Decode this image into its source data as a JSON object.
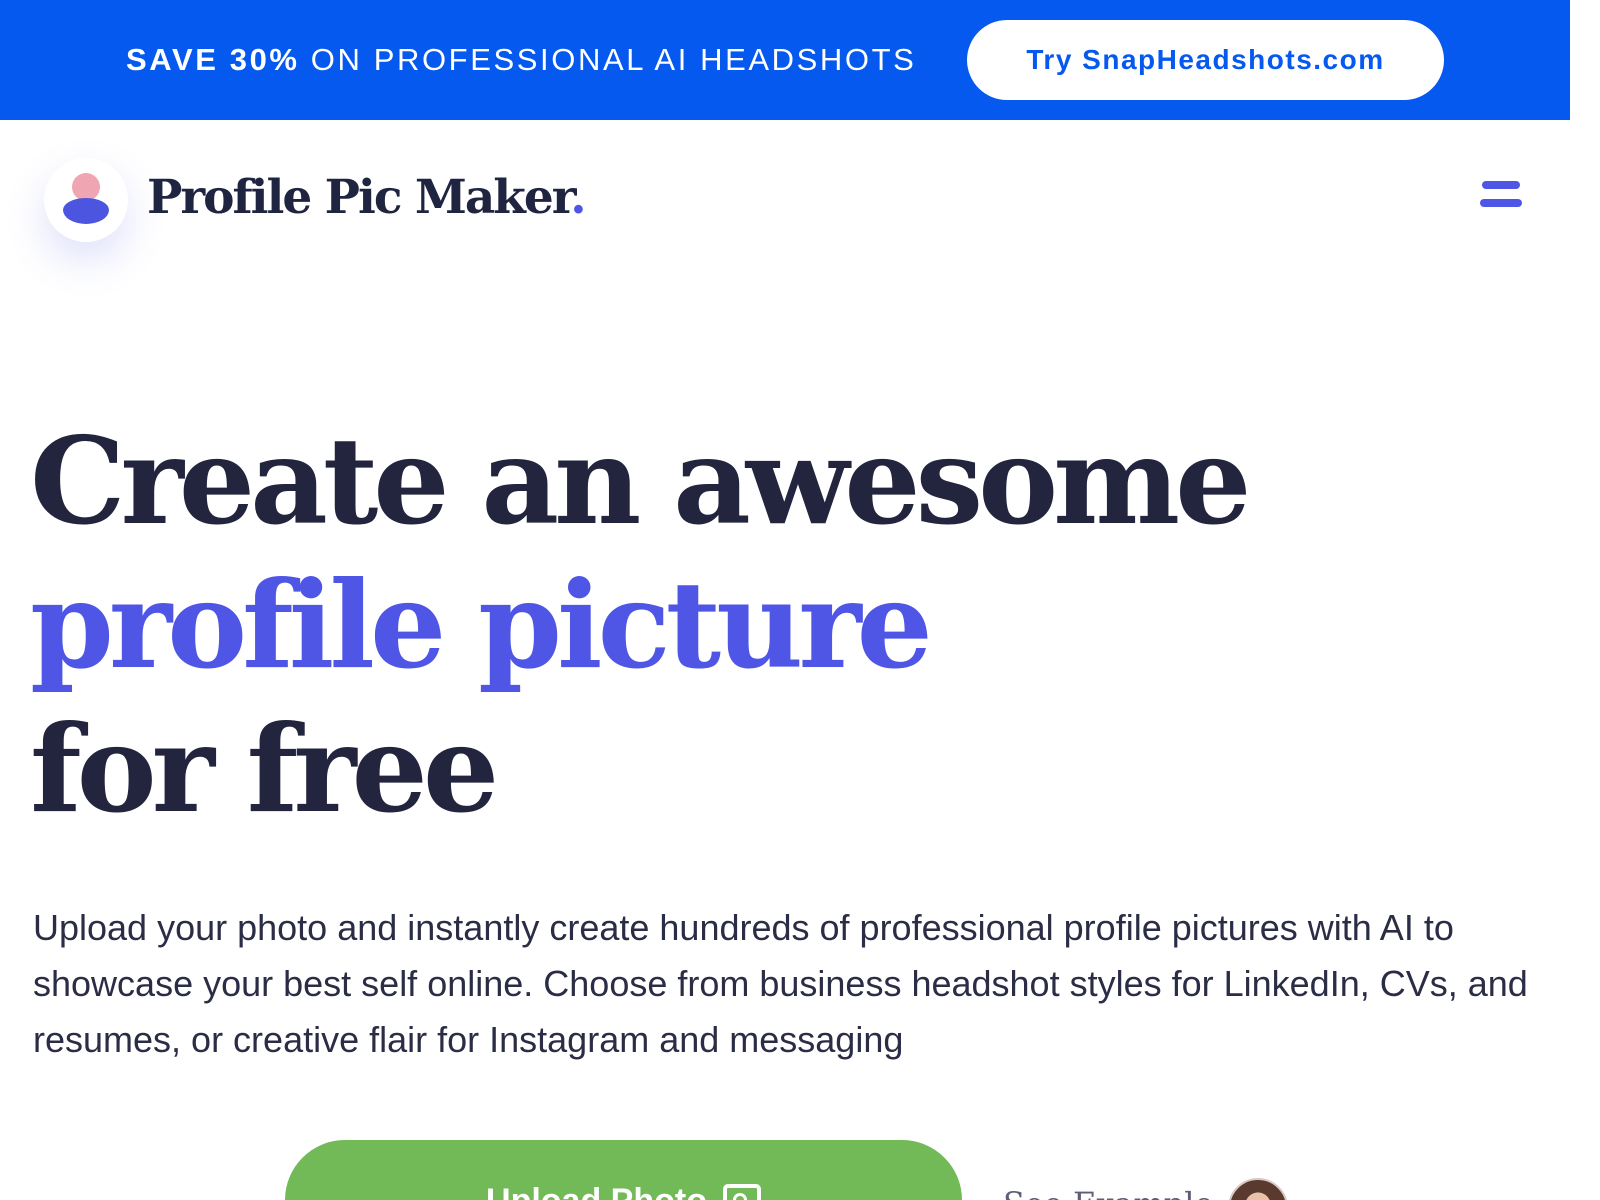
{
  "banner": {
    "highlight": "SAVE 30%",
    "text": " ON PROFESSIONAL AI HEADSHOTS",
    "cta_label": "Try SnapHeadshots.com"
  },
  "nav": {
    "logo_text": "Profile Pic Maker",
    "logo_dot": ".",
    "menu_icon": "hamburger-menu-icon"
  },
  "hero": {
    "title_line1": "Create an awesome",
    "title_line2": "profile picture",
    "title_line3": "for free",
    "description": "Upload your photo and instantly create hundreds of professional profile pictures with AI to showcase your best self online. Choose from business headshot styles for LinkedIn, CVs, and resumes, or creative flair for Instagram and messaging",
    "upload_label": "Upload Photo",
    "upload_icon": "image-icon",
    "see_example_label": "See Example"
  },
  "colors": {
    "banner_bg": "#0559ef",
    "accent": "#4f56e6",
    "heading": "#23253f",
    "upload_bg": "#72ba58"
  }
}
